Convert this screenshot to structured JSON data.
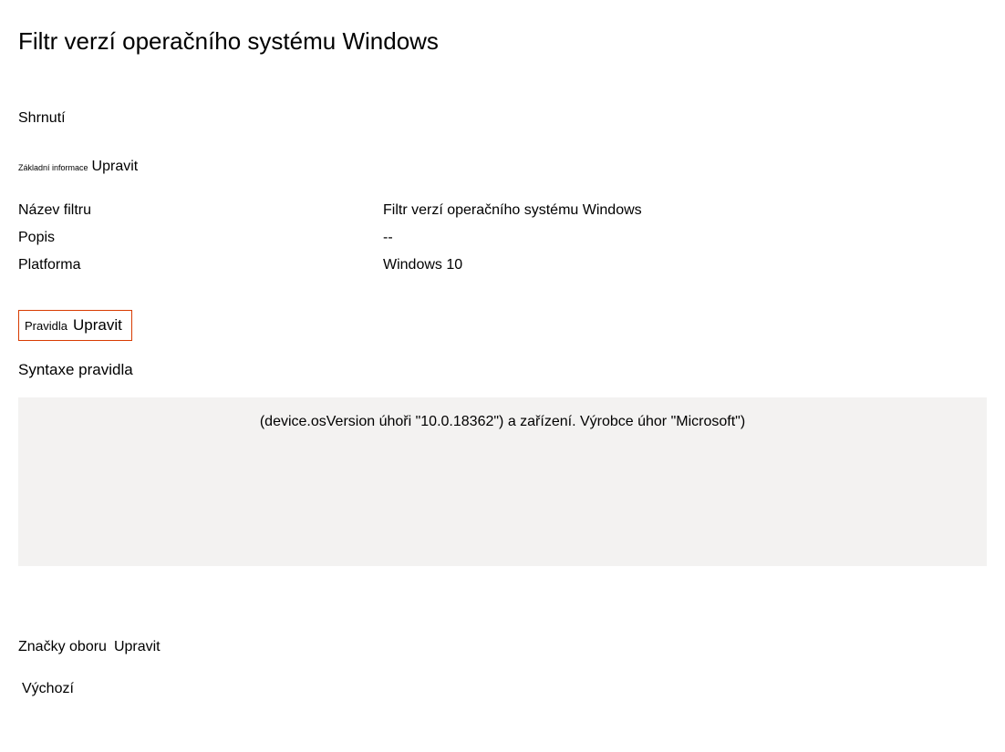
{
  "title": "Filtr verzí operačního systému Windows",
  "summary": {
    "header": "Shrnutí"
  },
  "basic": {
    "label": "Základní informace",
    "edit": "Upravit"
  },
  "info": {
    "filter_name_label": "Název filtru",
    "filter_name_value": "Filtr verzí operačního systému Windows",
    "description_label": "Popis",
    "description_value": "--",
    "platform_label": "Platforma",
    "platform_value": "Windows 10"
  },
  "rules": {
    "label": "Pravidla",
    "edit": "Upravit",
    "syntax_label": "Syntaxe pravidla",
    "syntax_value": "(device.osVersion úhoři \"10.0.18362\") a zařízení. Výrobce úhor \"Microsoft\")"
  },
  "scope": {
    "label": "Značky oboru",
    "edit": "Upravit",
    "value": "Výchozí"
  }
}
